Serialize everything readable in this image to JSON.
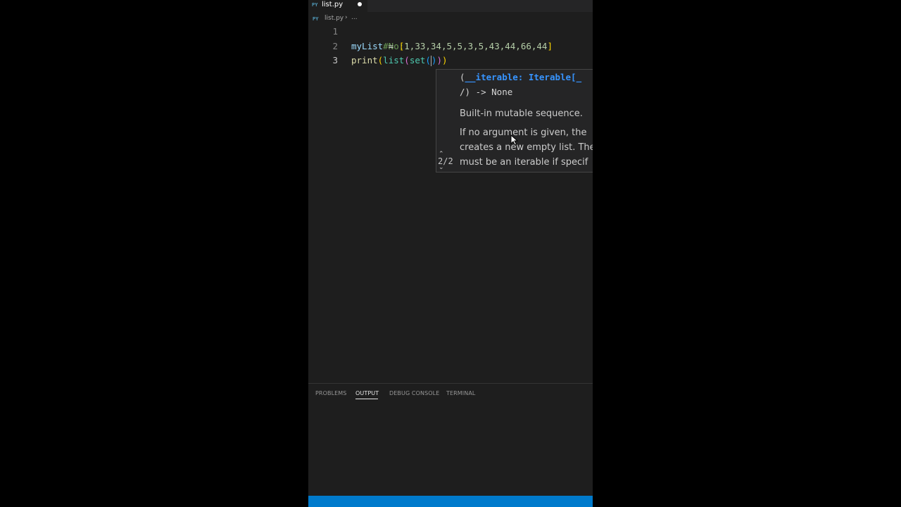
{
  "tab": {
    "icon": "PY",
    "label": "list.py",
    "dirty": true
  },
  "breadcrumb": {
    "icon": "PY",
    "file": "list.py",
    "separator": "›",
    "more": "..."
  },
  "editor": {
    "lines": [
      {
        "number": "1",
        "text": "#No:1"
      },
      {
        "number": "2",
        "text": "myList = [1,33,34,5,5,3,5,43,44,66,44]"
      },
      {
        "number": "3",
        "text": "print(list(set()))"
      }
    ],
    "line2": {
      "var": "myList",
      "eq": " = ",
      "open": "[",
      "values": "1,33,34,5,5,3,5,43,44,66,44",
      "close": "]"
    },
    "line3": {
      "fn_print": "print",
      "p1": "(",
      "fn_list": "list",
      "p2": "(",
      "fn_set": "set",
      "p3": "(",
      "p3c": ")",
      "p2c": ")",
      "p1c": ")"
    }
  },
  "signature_help": {
    "count": "2/2",
    "open_paren": "(",
    "param": "__iterable: Iterable[_",
    "line2": "/) -> None",
    "doc": [
      "Built-in mutable sequence.",
      "If no argument is given, the",
      "creates a new empty list. The",
      "must be an iterable if specif"
    ]
  },
  "panel": {
    "tabs": [
      "PROBLEMS",
      "OUTPUT",
      "DEBUG CONSOLE",
      "TERMINAL"
    ],
    "active": "OUTPUT"
  },
  "colors": {
    "accent": "#007acc",
    "editor_bg": "#1e1e1e"
  }
}
